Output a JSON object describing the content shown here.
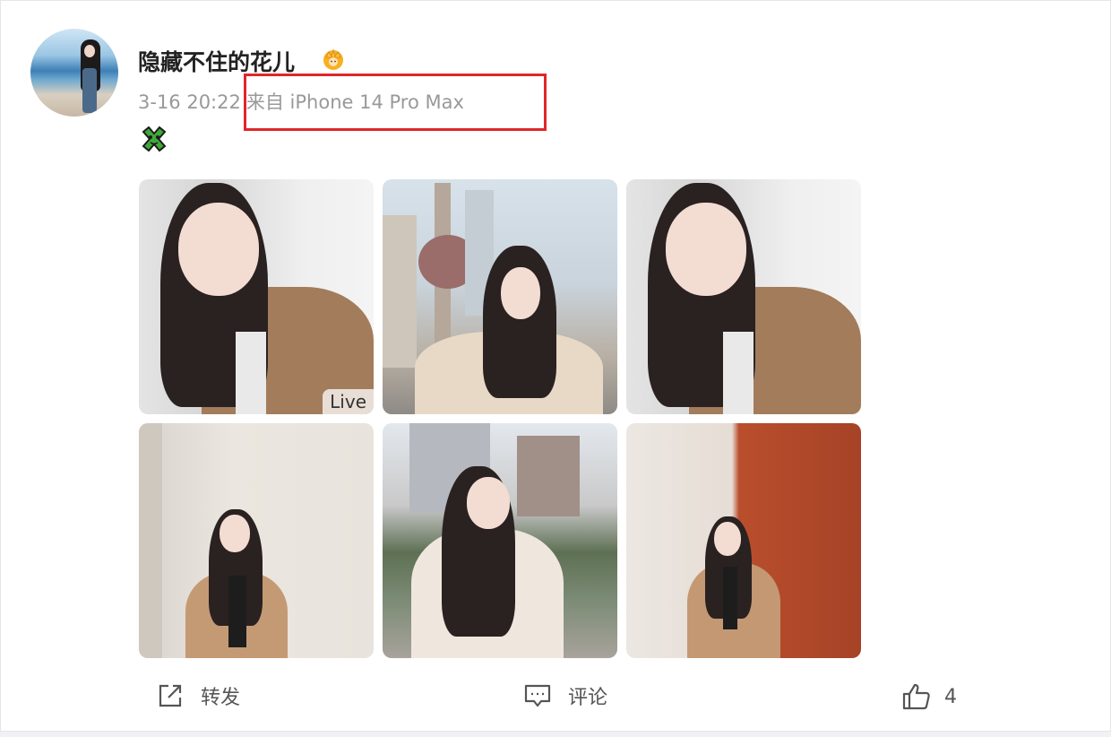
{
  "post": {
    "username": "隐藏不住的花儿",
    "time": "3-16 20:22",
    "source": "来自 iPhone 14 Pro Max",
    "photos": [
      {
        "badge": "Live"
      },
      {
        "badge": ""
      },
      {
        "badge": ""
      },
      {
        "badge": ""
      },
      {
        "badge": ""
      },
      {
        "badge": ""
      }
    ]
  },
  "actions": {
    "share_label": "转发",
    "comment_label": "评论",
    "like_count": "4"
  },
  "colors": {
    "highlight": "#e0262b",
    "meta_text": "#999999",
    "username_text": "#222222"
  },
  "icons": [
    "crown-icon",
    "green-sticker-icon",
    "share-icon",
    "comment-icon",
    "like-icon"
  ]
}
